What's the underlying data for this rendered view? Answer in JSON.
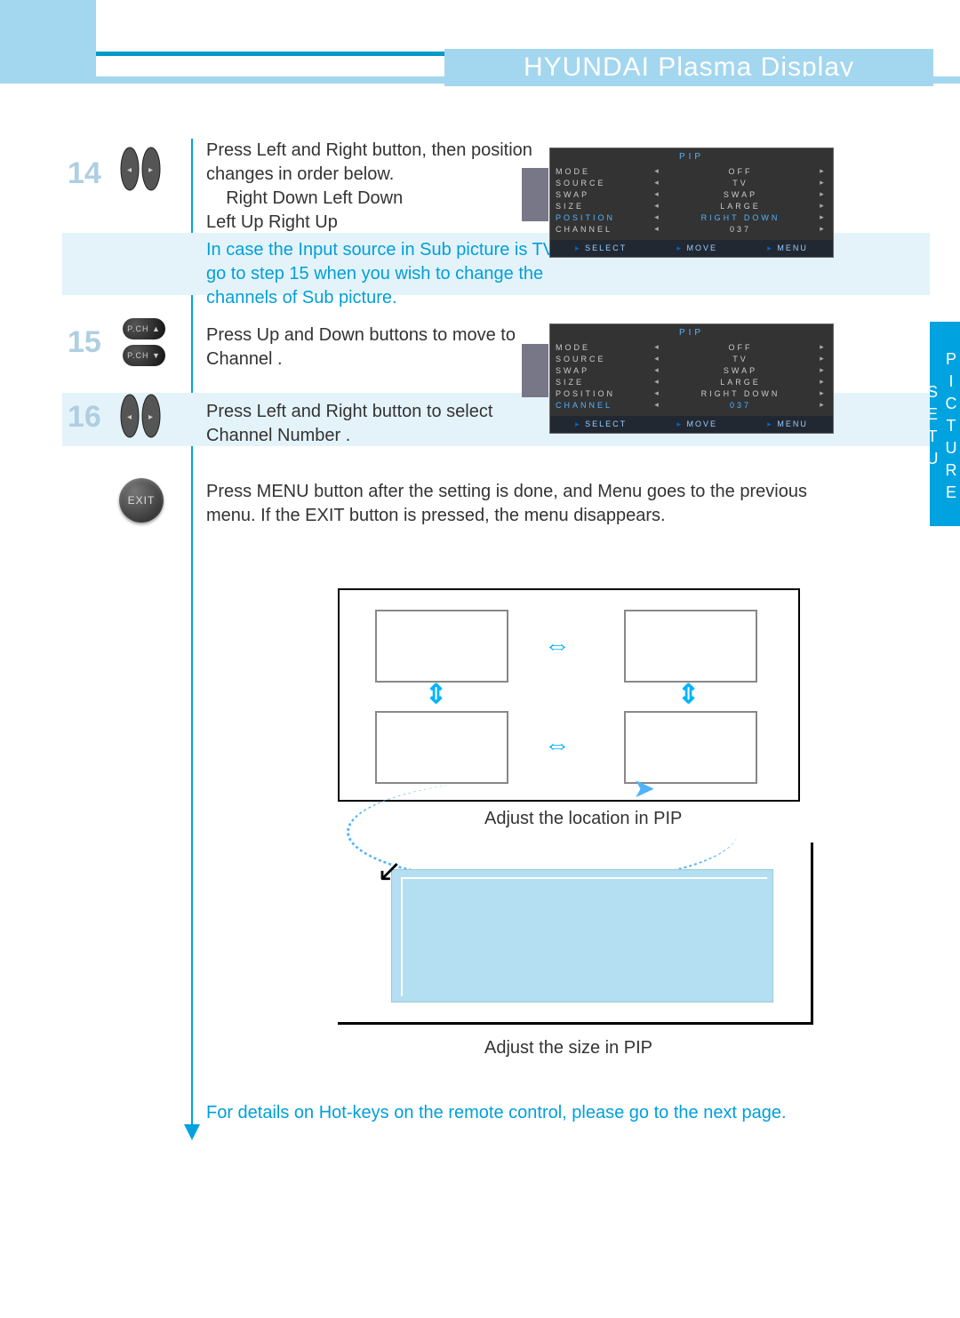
{
  "header": {
    "title": "HYUNDAI Plasma Display"
  },
  "section_tab": "PICTURE SETU",
  "steps": {
    "s14": {
      "num": "14",
      "line1": "Press Left and Right button, then position",
      "line2": "changes in order below.",
      "line3": "Right Down   Left Down",
      "line4": "Left Up    Right Up"
    },
    "note14": {
      "l1": "In case the Input source in Sub picture is TV,",
      "l2": "go to step 15 when you wish to change the",
      "l3": "channels of Sub picture."
    },
    "s15": {
      "num": "15",
      "text": "Press Up and Down buttons to move to Channel ."
    },
    "s16": {
      "num": "16",
      "text": "Press Left and Right button to select Channel Number ."
    },
    "exit": {
      "label": "EXIT",
      "text": "Press MENU button after the setting is done, and Menu goes to the previous menu. If the EXIT button is pressed, the menu disappears."
    }
  },
  "osd1": {
    "title": "PIP",
    "rows": [
      {
        "label": "MODE",
        "val": "OFF"
      },
      {
        "label": "SOURCE",
        "val": "TV"
      },
      {
        "label": "SWAP",
        "val": "SWAP"
      },
      {
        "label": "SIZE",
        "val": "LARGE"
      },
      {
        "label": "POSITION",
        "val": "RIGHT DOWN",
        "sel": true
      },
      {
        "label": "CHANNEL",
        "val": "037"
      }
    ],
    "foot": {
      "a": "SELECT",
      "b": "MOVE",
      "c": "MENU"
    }
  },
  "osd2": {
    "title": "PIP",
    "rows": [
      {
        "label": "MODE",
        "val": "OFF"
      },
      {
        "label": "SOURCE",
        "val": "TV"
      },
      {
        "label": "SWAP",
        "val": "SWAP"
      },
      {
        "label": "SIZE",
        "val": "LARGE"
      },
      {
        "label": "POSITION",
        "val": "RIGHT DOWN"
      },
      {
        "label": "CHANNEL",
        "val": "037",
        "sel": true
      }
    ],
    "foot": {
      "a": "SELECT",
      "b": "MOVE",
      "c": "MENU"
    }
  },
  "diagram": {
    "cap1": "Adjust the location in PIP",
    "cap2": "Adjust the size in PIP"
  },
  "pch": {
    "up": "P.CH ▲",
    "down": "P.CH ▼"
  },
  "footnote": "For details on Hot-keys on the remote control, please go to the next page."
}
